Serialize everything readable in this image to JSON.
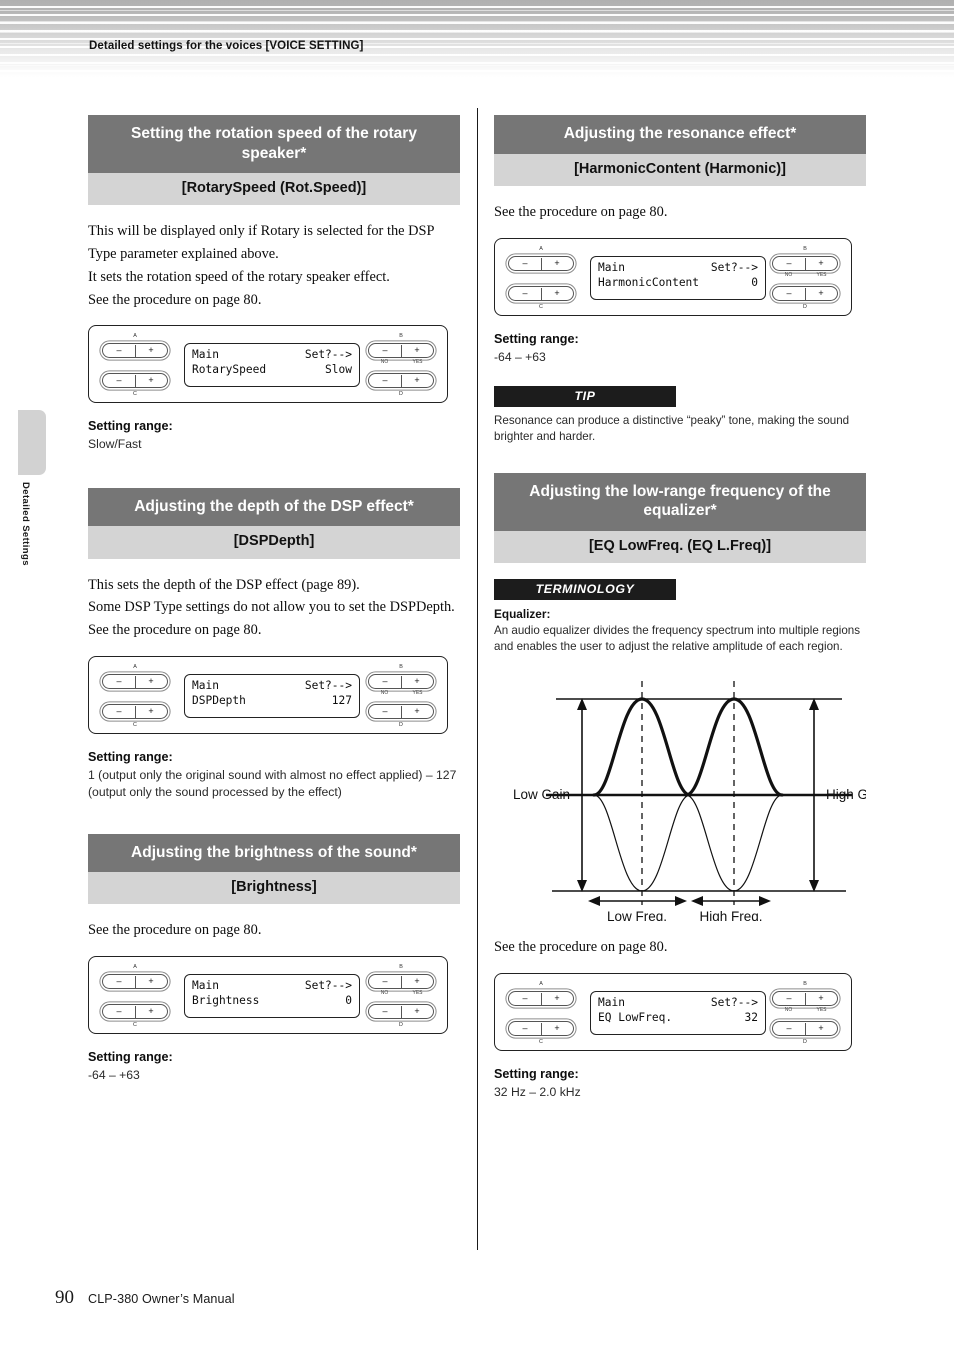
{
  "header": {
    "running_head": "Detailed settings for the voices [VOICE SETTING]"
  },
  "side_tab": {
    "label": "Detailed Settings"
  },
  "footer": {
    "page_number": "90",
    "manual_title": "CLP-380 Owner’s Manual"
  },
  "panel_common": {
    "tag_a": "A",
    "tag_b": "B",
    "tag_c": "C",
    "tag_d": "D",
    "minus": "–",
    "plus": "+",
    "no": "NO",
    "yes": "YES",
    "lcd_line1_left": "Main",
    "lcd_line1_right": "Set?-->"
  },
  "left_column": {
    "sections": [
      {
        "title": "Setting the rotation speed of the rotary speaker*",
        "subtitle": "[RotarySpeed (Rot.Speed)]",
        "body": "This will be displayed only if Rotary is selected for the DSP Type parameter explained above.\nIt sets the rotation speed of the rotary speaker effect.\nSee the procedure on page 80.",
        "lcd": {
          "line1_left": "Main",
          "line1_right": "Set?-->",
          "line2_left": "RotarySpeed",
          "line2_right": "Slow"
        },
        "range_label": "Setting range:",
        "range_value": "Slow/Fast"
      },
      {
        "title": "Adjusting the depth of the DSP effect*",
        "subtitle": "[DSPDepth]",
        "body": "This sets the depth of the DSP effect (page 89).\nSome DSP Type settings do not allow you to set the DSPDepth.\nSee the procedure on page 80.",
        "lcd": {
          "line1_left": "Main",
          "line1_right": "Set?-->",
          "line2_left": "DSPDepth",
          "line2_right": "127"
        },
        "range_label": "Setting range:",
        "range_value": "1 (output only the original sound with almost no effect applied) – 127 (output only the sound processed by the effect)"
      },
      {
        "title": "Adjusting the brightness of the sound*",
        "subtitle": "[Brightness]",
        "body": "See the procedure on page 80.",
        "lcd": {
          "line1_left": "Main",
          "line1_right": "Set?-->",
          "line2_left": "Brightness",
          "line2_right": "0"
        },
        "range_label": "Setting range:",
        "range_value": "-64 – +63"
      }
    ]
  },
  "right_column": {
    "sections": [
      {
        "title": "Adjusting the resonance effect*",
        "subtitle": "[HarmonicContent (Harmonic)]",
        "body": "See the procedure on page 80.",
        "lcd": {
          "line1_left": "Main",
          "line1_right": "Set?-->",
          "line2_left": "HarmonicContent",
          "line2_right": "0"
        },
        "range_label": "Setting range:",
        "range_value": "-64 – +63",
        "tip": {
          "banner": "TIP",
          "text": "Resonance can produce a distinctive “peaky” tone, making the sound brighter and harder."
        }
      },
      {
        "title": "Adjusting the low-range frequency of the equalizer*",
        "subtitle": "[EQ LowFreq. (EQ L.Freq)]",
        "terminology": {
          "banner": "TERMINOLOGY",
          "heading": "Equalizer:",
          "text": "An audio equalizer divides the frequency spectrum into multiple regions and enables the user to adjust the relative amplitude of each region."
        },
        "body": "See the procedure on page 80.",
        "lcd": {
          "line1_left": "Main",
          "line1_right": "Set?-->",
          "line2_left": "EQ LowFreq.",
          "line2_right": "32"
        },
        "range_label": "Setting range:",
        "range_value": "32 Hz – 2.0 kHz"
      }
    ]
  },
  "eq_diagram": {
    "label_low_gain": "Low Gain",
    "label_high_gain": "High Gain",
    "label_low_freq": "Low Freq.",
    "label_high_freq": "High Freq."
  },
  "colors": {
    "heading_bar": "#767676",
    "subheading_bar": "#d4d4d4",
    "banner_bar": "#1c1c1c",
    "side_tab": "#d2d2d2"
  }
}
